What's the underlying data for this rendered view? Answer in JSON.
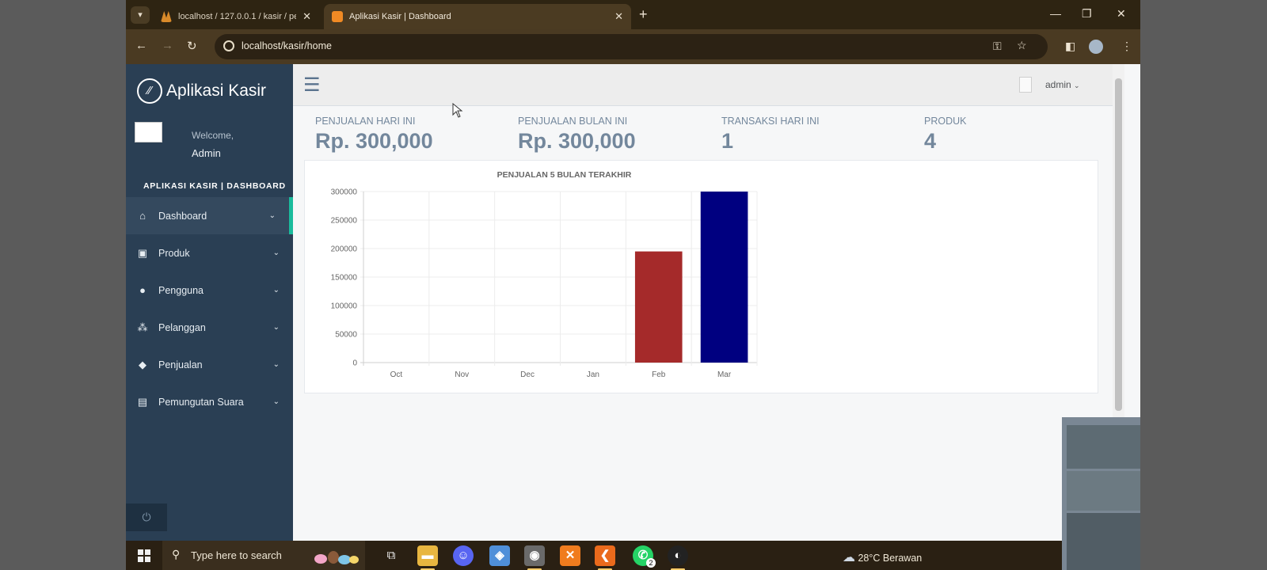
{
  "browser": {
    "tabs": [
      {
        "title": "localhost / 127.0.0.1 / kasir / pe"
      },
      {
        "title": "Aplikasi Kasir | Dashboard"
      }
    ],
    "url": "localhost/kasir/home"
  },
  "sidebar": {
    "brand": "Aplikasi Kasir",
    "welcome": "Welcome,",
    "user": "Admin",
    "section_title": "APLIKASI KASIR | DASHBOARD",
    "items": [
      {
        "label": "Dashboard",
        "icon": "home-icon",
        "active": true
      },
      {
        "label": "Produk",
        "icon": "briefcase-icon"
      },
      {
        "label": "Pengguna",
        "icon": "user-icon"
      },
      {
        "label": "Pelanggan",
        "icon": "users-icon"
      },
      {
        "label": "Penjualan",
        "icon": "tag-icon"
      },
      {
        "label": "Pemungutan Suara",
        "icon": "archive-icon"
      }
    ]
  },
  "topnav": {
    "user": "admin"
  },
  "stats": [
    {
      "label": "PENJUALAN HARI INI",
      "value": "Rp. 300,000"
    },
    {
      "label": "PENJUALAN BULAN INI",
      "value": "Rp. 300,000"
    },
    {
      "label": "TRANSAKSI HARI INI",
      "value": "1"
    },
    {
      "label": "PRODUK",
      "value": "4"
    }
  ],
  "chart_data": {
    "type": "bar",
    "title": "PENJUALAN 5 BULAN TERAKHIR",
    "categories": [
      "Oct",
      "Nov",
      "Dec",
      "Jan",
      "Feb",
      "Mar"
    ],
    "values": [
      0,
      0,
      0,
      0,
      195000,
      300000
    ],
    "colors": [
      "#a52a2a",
      "#a52a2a",
      "#a52a2a",
      "#a52a2a",
      "#a52a2a",
      "#000080"
    ],
    "ylim": [
      0,
      300000
    ],
    "yticks": [
      0,
      50000,
      100000,
      150000,
      200000,
      250000,
      300000
    ],
    "grid": true,
    "xlabel": "",
    "ylabel": ""
  },
  "taskbar": {
    "search_placeholder": "Type here to search",
    "weather": "28°C  Berawan",
    "badge_whatsapp": "2"
  }
}
